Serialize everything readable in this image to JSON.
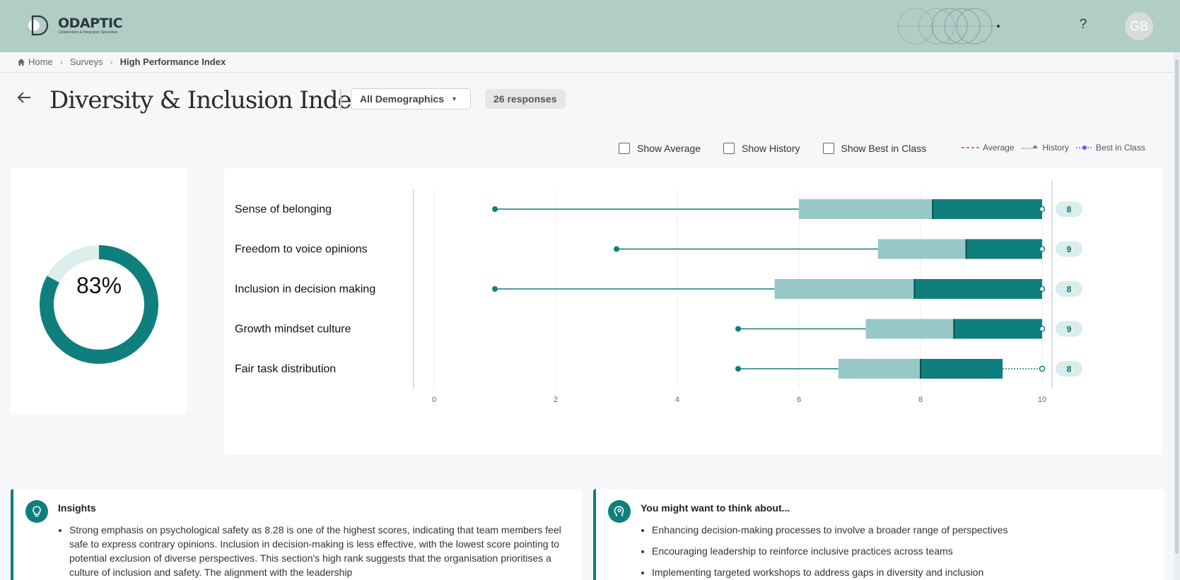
{
  "brand": {
    "name": "ODAPTIC",
    "tagline": "Collaboration & Integration Specialists"
  },
  "header": {
    "help_label": "?",
    "avatar_initials": "GB"
  },
  "breadcrumb": {
    "home": "Home",
    "surveys": "Surveys",
    "current": "High Performance Index"
  },
  "page": {
    "title": "Diversity & Inclusion Index",
    "demographic_filter": "All Demographics",
    "responses": "26 responses"
  },
  "toggles": {
    "average": "Show Average",
    "history": "Show History",
    "best": "Show Best in Class"
  },
  "legend": {
    "average": "Average",
    "history": "History",
    "best": "Best in Class"
  },
  "colors": {
    "accent": "#0e7f7c",
    "accent_light": "#96c9c7",
    "header_bg": "#b0cdc6",
    "average_line": "#e53935",
    "best_line": "#7c4dff"
  },
  "score": {
    "percent_label": "83%",
    "value": 0.83
  },
  "chart_data": {
    "type": "bar",
    "categories": [
      "Sense of belonging",
      "Freedom to voice opinions",
      "Inclusion in decision making",
      "Growth mindset culture",
      "Fair task distribution"
    ],
    "min": [
      1,
      3,
      1,
      5,
      5
    ],
    "q1": [
      6.0,
      7.3,
      5.6,
      7.1,
      6.65
    ],
    "mean": [
      8.2,
      8.75,
      7.9,
      8.55,
      8.0
    ],
    "q3": [
      10,
      10,
      10,
      10,
      9.35
    ],
    "max": [
      10,
      10,
      10,
      10,
      10
    ],
    "labels": [
      "8",
      "9",
      "8",
      "9",
      "8"
    ],
    "xlim": [
      0,
      10
    ],
    "xticks": [
      "0",
      "2",
      "4",
      "6",
      "8",
      "10"
    ],
    "grid": true
  },
  "insights": {
    "title": "Insights",
    "items": [
      "Strong emphasis on psychological safety as 8.28 is one of the highest scores, indicating that team members feel safe to express contrary opinions. Inclusion in decision-making is less effective, with the lowest score pointing to potential exclusion of diverse perspectives. This section's high rank suggests that the organisation prioritises a culture of inclusion and safety. The alignment with the leadership"
    ]
  },
  "think": {
    "title": "You might want to think about...",
    "items": [
      "Enhancing decision-making processes to involve a broader range of perspectives",
      "Encouraging leadership to reinforce inclusive practices across teams",
      "Implementing targeted workshops to address gaps in diversity and inclusion"
    ]
  }
}
